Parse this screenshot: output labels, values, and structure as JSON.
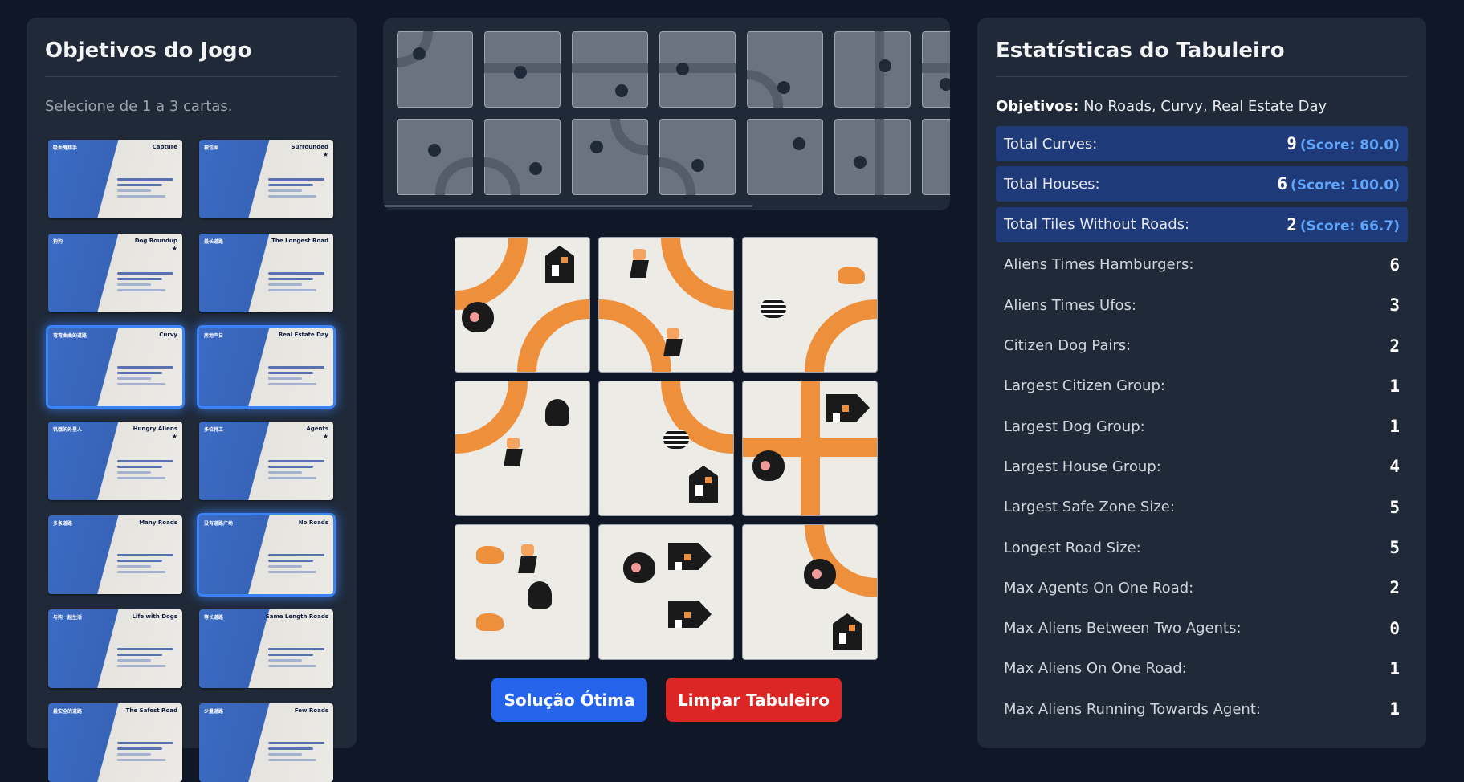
{
  "objectives_panel": {
    "title": "Objetivos do Jogo",
    "subtitle": "Selecione de 1 a 3 cartas.",
    "cards": [
      {
        "name": "Capture",
        "zh": "吸血鬼猎手",
        "star": false,
        "selected": false
      },
      {
        "name": "Surrounded",
        "zh": "被包围",
        "star": true,
        "selected": false
      },
      {
        "name": "Dog Roundup",
        "zh": "狗狗",
        "star": true,
        "selected": false
      },
      {
        "name": "The Longest Road",
        "zh": "最长道路",
        "star": false,
        "selected": false
      },
      {
        "name": "Curvy",
        "zh": "弯弯曲曲的道路",
        "star": false,
        "selected": true
      },
      {
        "name": "Real Estate Day",
        "zh": "房地产日",
        "star": false,
        "selected": true
      },
      {
        "name": "Hungry Aliens",
        "zh": "饥饿的外星人",
        "star": true,
        "selected": false
      },
      {
        "name": "Agents",
        "zh": "多位特工",
        "star": true,
        "selected": false
      },
      {
        "name": "Many Roads",
        "zh": "多条道路",
        "star": false,
        "selected": false
      },
      {
        "name": "No Roads",
        "zh": "没有道路广场",
        "star": false,
        "selected": true
      },
      {
        "name": "Life with Dogs",
        "zh": "与狗一起生活",
        "star": false,
        "selected": false
      },
      {
        "name": "Same Length Roads",
        "zh": "等长道路",
        "star": false,
        "selected": false
      },
      {
        "name": "The Safest Road",
        "zh": "最安全的道路",
        "star": false,
        "selected": false
      },
      {
        "name": "Few Roads",
        "zh": "少量道路",
        "star": false,
        "selected": false
      }
    ]
  },
  "buttons": {
    "optimal": "Solução Ótima",
    "clear": "Limpar Tabuleiro"
  },
  "stats_panel": {
    "title": "Estatísticas do Tabuleiro",
    "objectives_label": "Objetivos:",
    "objectives_value": "No Roads, Curvy, Real Estate Day",
    "rows": [
      {
        "label": "Total Curves:",
        "value": "9",
        "score": "(Score: 80.0)",
        "highlight": true
      },
      {
        "label": "Total Houses:",
        "value": "6",
        "score": "(Score: 100.0)",
        "highlight": true
      },
      {
        "label": "Total Tiles Without Roads:",
        "value": "2",
        "score": "(Score: 66.7)",
        "highlight": true
      },
      {
        "label": "Aliens Times Hamburgers:",
        "value": "6",
        "score": "",
        "highlight": false
      },
      {
        "label": "Aliens Times Ufos:",
        "value": "3",
        "score": "",
        "highlight": false
      },
      {
        "label": "Citizen Dog Pairs:",
        "value": "2",
        "score": "",
        "highlight": false
      },
      {
        "label": "Largest Citizen Group:",
        "value": "1",
        "score": "",
        "highlight": false
      },
      {
        "label": "Largest Dog Group:",
        "value": "1",
        "score": "",
        "highlight": false
      },
      {
        "label": "Largest House Group:",
        "value": "4",
        "score": "",
        "highlight": false
      },
      {
        "label": "Largest Safe Zone Size:",
        "value": "5",
        "score": "",
        "highlight": false
      },
      {
        "label": "Longest Road Size:",
        "value": "5",
        "score": "",
        "highlight": false
      },
      {
        "label": "Max Agents On One Road:",
        "value": "2",
        "score": "",
        "highlight": false
      },
      {
        "label": "Max Aliens Between Two Agents:",
        "value": "0",
        "score": "",
        "highlight": false
      },
      {
        "label": "Max Aliens On One Road:",
        "value": "1",
        "score": "",
        "highlight": false
      },
      {
        "label": "Max Aliens Running Towards Agent:",
        "value": "1",
        "score": "",
        "highlight": false
      }
    ]
  },
  "colors": {
    "background": "#101828",
    "panel": "#1f2937",
    "primary_button": "#2563eb",
    "danger_button": "#dc2626",
    "road": "#ee8f3b",
    "highlight_row": "#1e3a78",
    "score_text": "#60a5fa"
  }
}
